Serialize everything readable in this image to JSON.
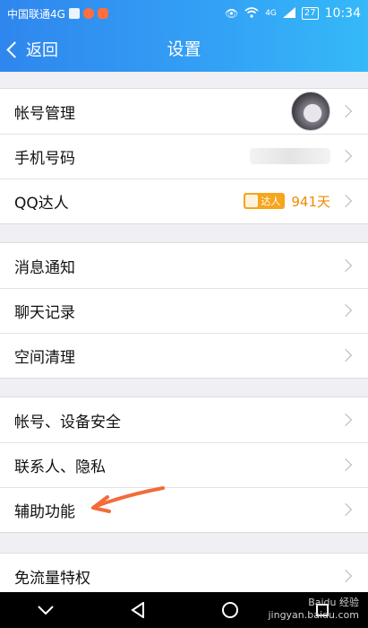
{
  "status_bar": {
    "carrier": "中国联通4G",
    "battery": "27",
    "time": "10:34",
    "signal_label": "4G"
  },
  "header": {
    "back_label": "返回",
    "title": "设置"
  },
  "groups": [
    {
      "items": [
        {
          "label": "帐号管理",
          "right": "avatar"
        },
        {
          "label": "手机号码",
          "right": "blurred"
        },
        {
          "label": "QQ达人",
          "badge": "达人",
          "days": "941天"
        }
      ]
    },
    {
      "items": [
        {
          "label": "消息通知"
        },
        {
          "label": "聊天记录"
        },
        {
          "label": "空间清理"
        }
      ]
    },
    {
      "items": [
        {
          "label": "帐号、设备安全"
        },
        {
          "label": "联系人、隐私"
        },
        {
          "label": "辅助功能"
        }
      ]
    },
    {
      "items": [
        {
          "label": "免流量特权"
        }
      ]
    }
  ],
  "colors": {
    "header_start": "#2f86ee",
    "header_end": "#35b9f8",
    "accent_orange": "#f08a00",
    "annotation_arrow": "#f26b3a"
  },
  "watermark": {
    "brand": "Baidu 经验",
    "url": "jingyan.baidu.com"
  }
}
